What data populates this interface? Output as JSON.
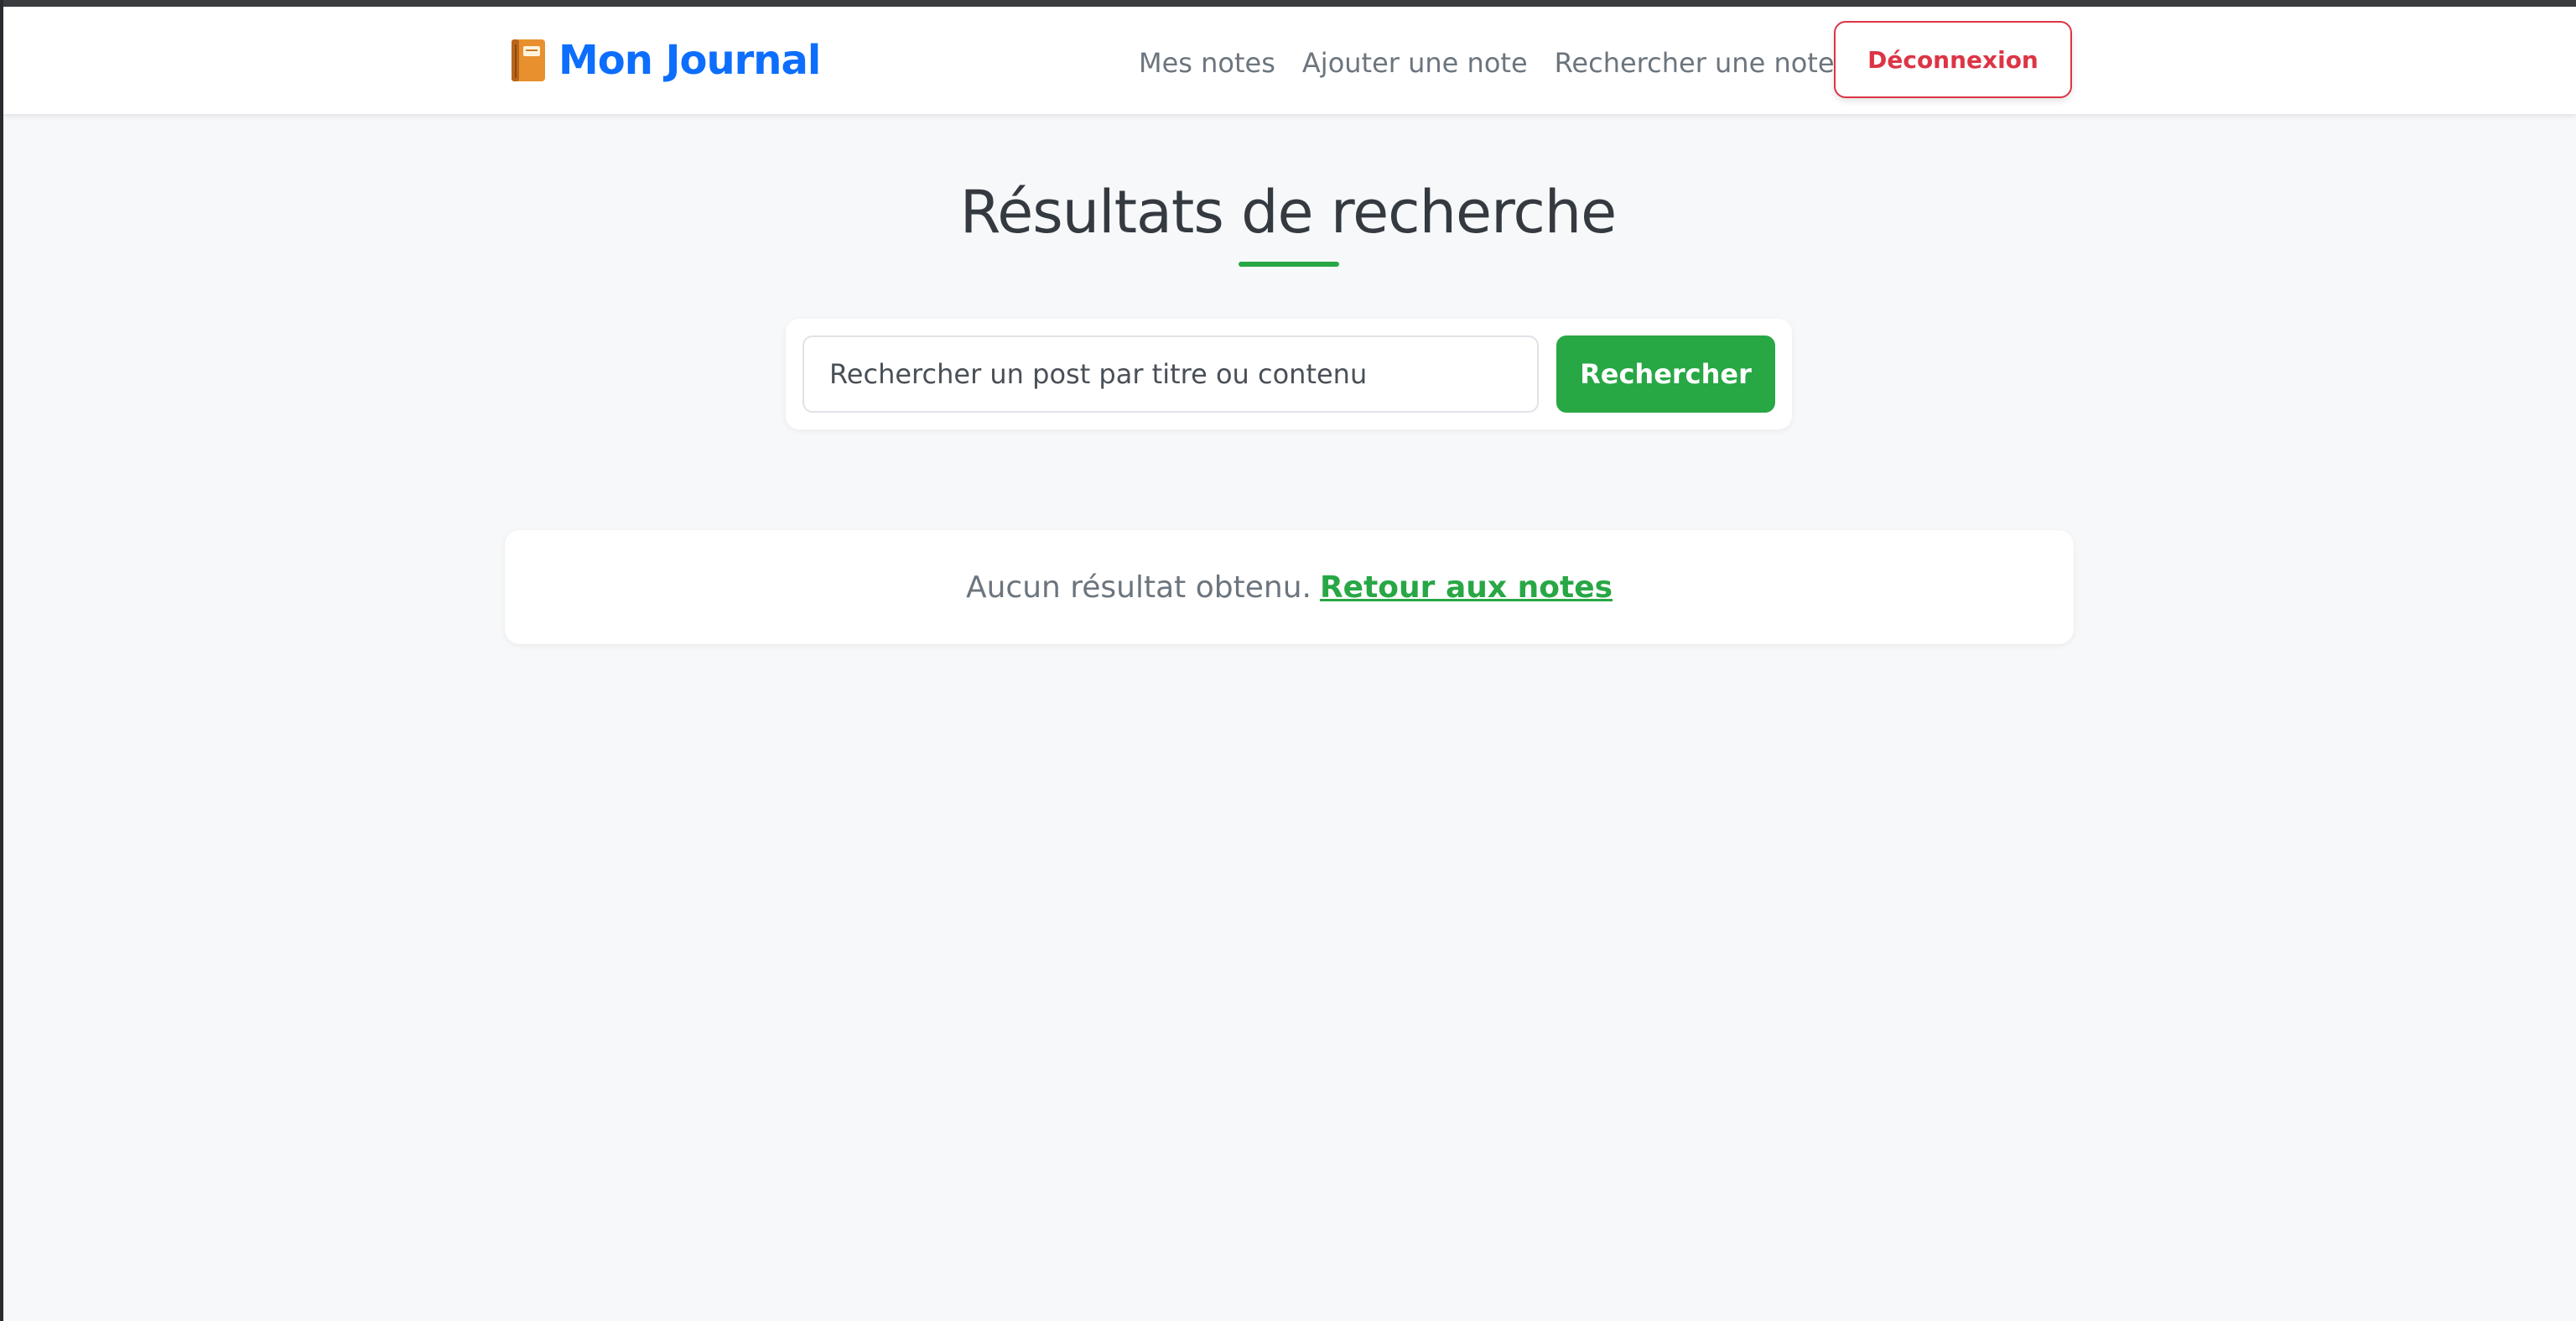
{
  "navbar": {
    "brand_label": "Mon Journal",
    "brand_icon": "notebook-icon",
    "links": [
      {
        "label": "Mes notes"
      },
      {
        "label": "Ajouter une note"
      },
      {
        "label": "Rechercher une note"
      }
    ],
    "logout_label": "Déconnexion"
  },
  "main": {
    "title": "Résultats de recherche",
    "search": {
      "placeholder": "Rechercher un post par titre ou contenu",
      "value": "",
      "button_label": "Rechercher"
    },
    "empty_state": {
      "message": "Aucun résultat obtenu.",
      "link_label": "Retour aux notes"
    }
  },
  "colors": {
    "brand": "#0d6efd",
    "accent_green": "#28a745",
    "danger": "#dc3545",
    "muted_text": "#6c757d",
    "title_text": "#343a40",
    "page_background": "#f7f8fa"
  }
}
